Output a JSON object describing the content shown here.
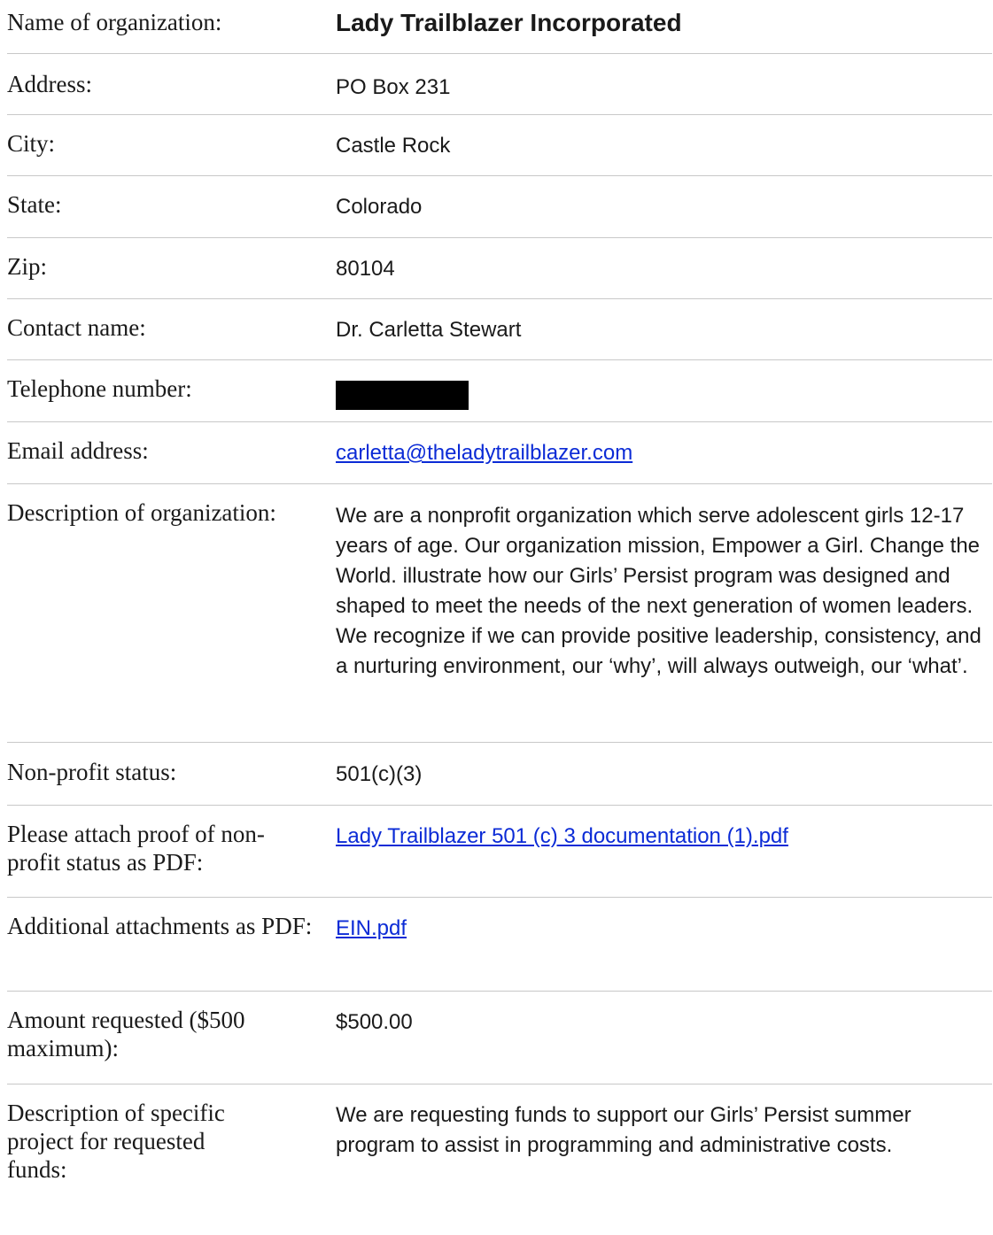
{
  "fields": [
    {
      "label": "Name of organization:",
      "value": "Lady Trailblazer Incorporated"
    },
    {
      "label": "Address:",
      "value": "PO Box 231"
    },
    {
      "label": "City:",
      "value": "Castle Rock"
    },
    {
      "label": "State:",
      "value": "Colorado"
    },
    {
      "label": "Zip:",
      "value": "80104"
    },
    {
      "label": "Contact name:",
      "value": "Dr. Carletta Stewart"
    },
    {
      "label": "Telephone number:",
      "value": ""
    },
    {
      "label": "Email address:",
      "value": "carletta@theladytrailblazer.com"
    },
    {
      "label": "Description of organization:",
      "value": "We are a nonprofit organization which serve adolescent girls 12-17 years of age. Our organization mission, Empower a Girl. Change the World. illustrate how our Girls’ Persist program was designed and shaped to meet the needs of the next generation of women leaders. We recognize if we can provide positive leadership, consistency, and a nurturing environment, our ‘why’, will always outweigh, our ‘what’."
    },
    {
      "label": "Non-profit status:",
      "value": "501(c)(3)"
    },
    {
      "label": "Please attach proof of non-profit status as PDF:",
      "value": "Lady Trailblazer 501 (c) 3 documentation (1).pdf"
    },
    {
      "label": "Additional attachments as PDF:",
      "value": "EIN.pdf"
    },
    {
      "label": "Amount requested ($500 maximum):",
      "value": "$500.00"
    },
    {
      "label": "Description of specific project for requested funds:",
      "value": "We are requesting funds to support our Girls’ Persist summer program to assist in programming and administrative costs."
    }
  ]
}
